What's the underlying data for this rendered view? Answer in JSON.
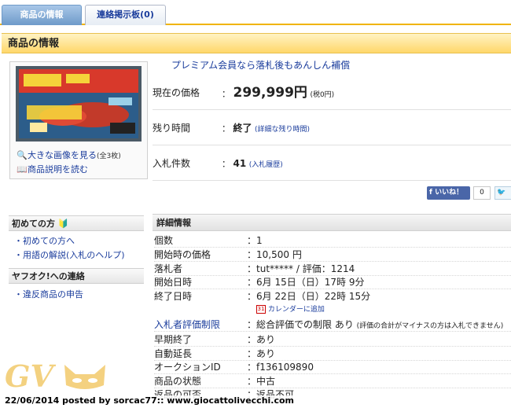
{
  "tabs": {
    "active": "商品の情報",
    "inactive": "連絡掲示板(0)"
  },
  "section_title": "商品の情報",
  "image_box": {
    "enlarge": "大きな画像を見る",
    "count": "(全3枚)",
    "description": "商品説明を読む"
  },
  "promo": "プレミアム会員なら落札後もあんしん補償",
  "price": {
    "current_label": "現在の価格",
    "current_value": "299,999円",
    "tax": "(税0円)",
    "remaining_label": "残り時間",
    "remaining_value": "終了",
    "remaining_link": "(詳細な残り時間)",
    "bids_label": "入札件数",
    "bids_value": "41",
    "bids_link": "(入札履歴)"
  },
  "social": {
    "like": "いいね！",
    "count": "0",
    "tweet": "ツ"
  },
  "sidebar": {
    "beginner_title": "初めての方",
    "beginner_links": [
      "初めての方へ",
      "用語の解説(入札のヘルプ)"
    ],
    "contact_title": "ヤフオク!への連絡",
    "contact_links": [
      "違反商品の申告"
    ]
  },
  "detail": {
    "title": "詳細情報",
    "rows": [
      {
        "label": "個数",
        "value": "1"
      },
      {
        "label": "開始時の価格",
        "value": "10,500 円"
      },
      {
        "label": "落札者",
        "value": "tut***** / 評価：1214"
      },
      {
        "label": "開始日時",
        "value": "6月 15日（日）17時 9分"
      },
      {
        "label": "終了日時",
        "value": "6月 22日（日）22時 15分"
      },
      {
        "label": "入札者評価制限",
        "value": "総合評価での制限 あり",
        "note": "(評価の合計がマイナスの方は入札できません)"
      },
      {
        "label": "早期終了",
        "value": "あり"
      },
      {
        "label": "自動延長",
        "value": "あり"
      },
      {
        "label": "オークションID",
        "value": "f136109890"
      },
      {
        "label": "商品の状態",
        "value": "中古"
      },
      {
        "label": "返品の可否",
        "value": "返品不可"
      }
    ],
    "calendar": "カレンダーに追加"
  },
  "watermark": {
    "logo": "GV",
    "caption": "22/06/2014 posted by sorcac77:: www.giocattolivecchi.com"
  },
  "colors": {
    "accent": "#ffd76a",
    "link": "#1a3c9c",
    "tab_active": "#6e9ac9"
  }
}
